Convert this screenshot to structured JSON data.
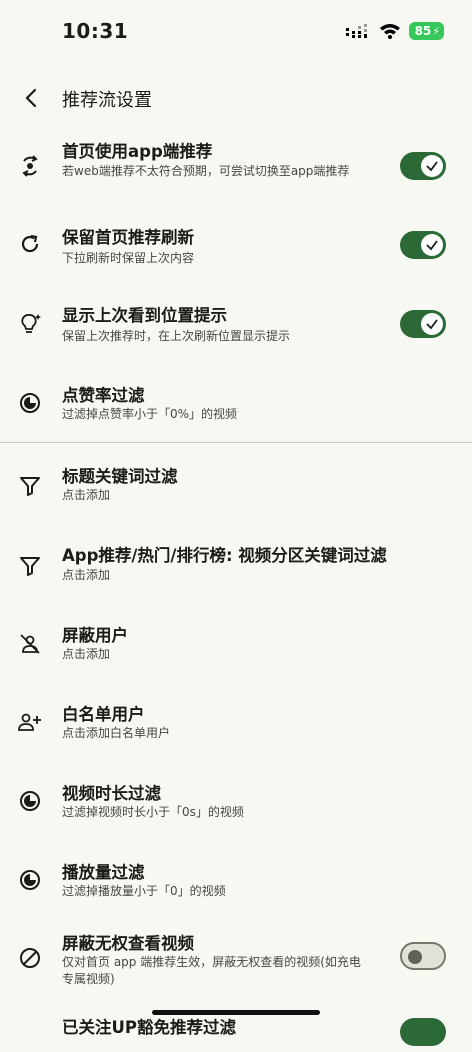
{
  "status_bar": {
    "time": "10:31",
    "battery": "85"
  },
  "header": {
    "title": "推荐流设置"
  },
  "settings": [
    {
      "title": "首页使用app端推荐",
      "subtitle": "若web端推荐不太符合预期，可尝试切换至app端推荐",
      "toggle": "on",
      "icon": "sync-icon"
    },
    {
      "title": "保留首页推荐刷新",
      "subtitle": "下拉刷新时保留上次内容",
      "toggle": "on",
      "icon": "refresh-icon"
    },
    {
      "title": "显示上次看到位置提示",
      "subtitle": "保留上次推荐时，在上次刷新位置显示提示",
      "toggle": "on",
      "icon": "lightbulb-icon"
    },
    {
      "title": "点赞率过滤",
      "subtitle": "过滤掉点赞率小于「0%」的视频",
      "icon": "contrast-icon"
    },
    {
      "title": "标题关键词过滤",
      "subtitle": "点击添加",
      "icon": "filter-icon"
    },
    {
      "title": "App推荐/热门/排行榜: 视频分区关键词过滤",
      "subtitle": "点击添加",
      "icon": "filter-icon"
    },
    {
      "title": "屏蔽用户",
      "subtitle": "点击添加",
      "icon": "person-off-icon"
    },
    {
      "title": "白名单用户",
      "subtitle": "点击添加白名单用户",
      "icon": "person-add-icon"
    },
    {
      "title": "视频时长过滤",
      "subtitle": "过滤掉视频时长小于「0s」的视频",
      "icon": "contrast-icon"
    },
    {
      "title": "播放量过滤",
      "subtitle": "过滤掉播放量小于「0」的视频",
      "icon": "contrast-icon"
    },
    {
      "title": "屏蔽无权查看视频",
      "subtitle": "仅对首页 app 端推荐生效，屏蔽无权查看的视频(如充电专属视频)",
      "toggle": "off",
      "icon": "block-icon"
    },
    {
      "title": "已关注UP豁免推荐过滤",
      "toggle": "on",
      "icon": ""
    }
  ],
  "colors": {
    "toggle_on": "#2b6a36",
    "background": "#f7f8f2",
    "battery": "#35c759"
  }
}
